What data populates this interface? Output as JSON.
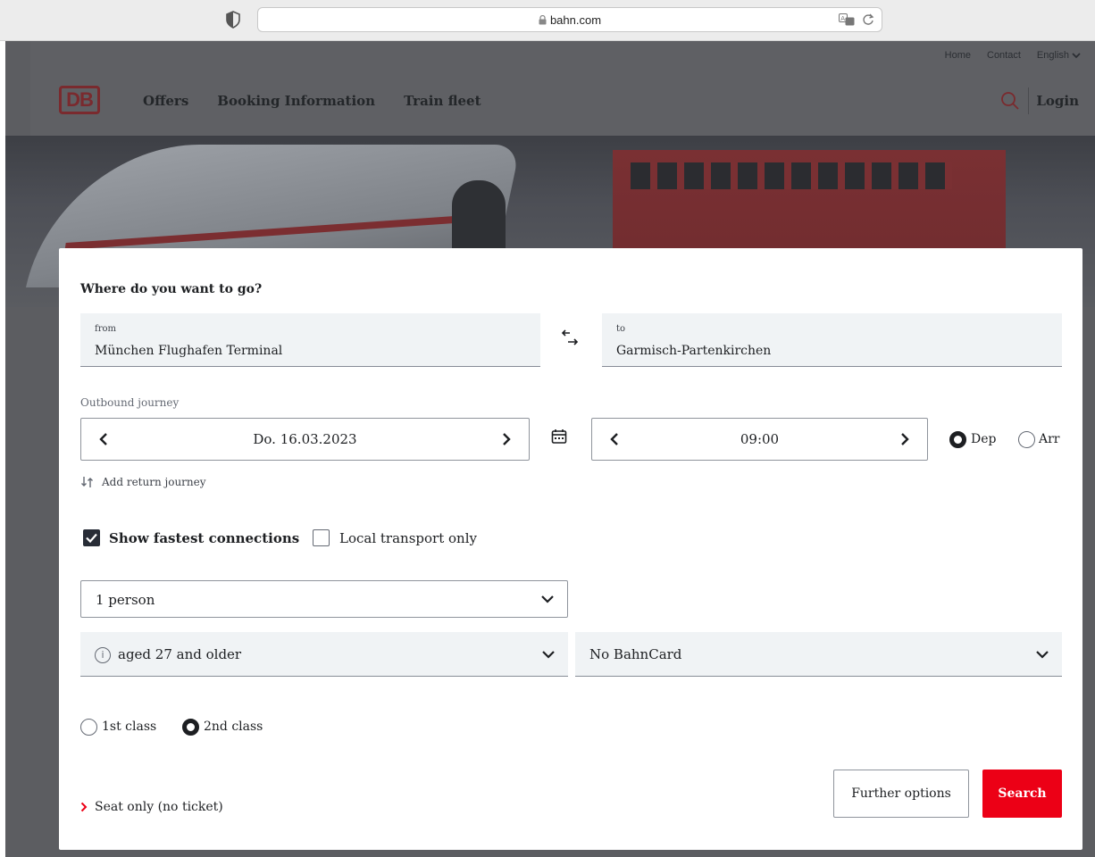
{
  "browser": {
    "url": "bahn.com"
  },
  "header": {
    "util_links": [
      "Home",
      "Contact",
      "English"
    ],
    "logo_text": "DB",
    "nav": [
      "Offers",
      "Booking Information",
      "Train fleet"
    ],
    "login_label": "Login"
  },
  "booking": {
    "title": "Where do you want to go?",
    "from": {
      "label": "from",
      "value": "München Flughafen Terminal"
    },
    "to": {
      "label": "to",
      "value": "Garmisch-Partenkirchen"
    },
    "outbound_label": "Outbound journey",
    "date_value": "Do. 16.03.2023",
    "time_value": "09:00",
    "dep_label": "Dep",
    "arr_label": "Arr",
    "dep_selected": true,
    "return_label": "Add return journey",
    "fastest_label": "Show fastest connections",
    "fastest_checked": true,
    "local_label": "Local transport only",
    "local_checked": false,
    "persons_value": "1 person",
    "age_value": "aged 27 and older",
    "bahncard_value": "No BahnCard",
    "class1_label": "1st class",
    "class2_label": "2nd class",
    "class_selected": "2nd",
    "seat_only_label": "Seat only (no ticket)",
    "further_options_label": "Further options",
    "search_label": "Search"
  },
  "colors": {
    "brand_red": "#ec0016",
    "overlay": "#5c5d61",
    "field_bg": "#f0f3f5"
  }
}
